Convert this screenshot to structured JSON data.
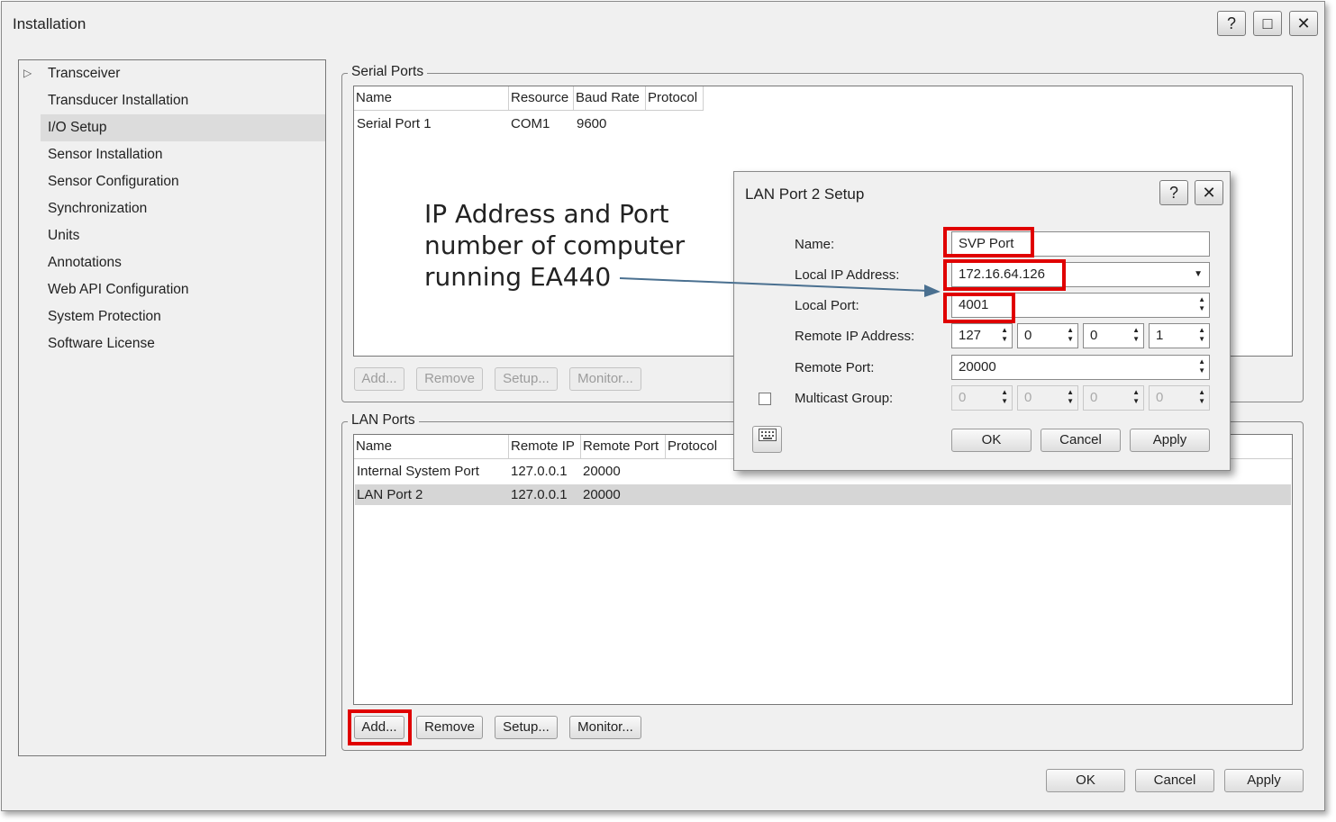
{
  "window": {
    "title": "Installation",
    "help": "?",
    "maximize": "□",
    "close": "✕"
  },
  "sidebar": {
    "items": [
      {
        "label": "Transceiver"
      },
      {
        "label": "Transducer Installation"
      },
      {
        "label": "I/O Setup"
      },
      {
        "label": "Sensor Installation"
      },
      {
        "label": "Sensor Configuration"
      },
      {
        "label": "Synchronization"
      },
      {
        "label": "Units"
      },
      {
        "label": "Annotations"
      },
      {
        "label": "Web API Configuration"
      },
      {
        "label": "System Protection"
      },
      {
        "label": "Software License"
      }
    ],
    "selected": "I/O Setup"
  },
  "serial_ports": {
    "title": "Serial Ports",
    "columns": [
      "Name",
      "Resource",
      "Baud Rate",
      "Protocol"
    ],
    "rows": [
      [
        "Serial Port 1",
        "COM1",
        "9600",
        ""
      ]
    ],
    "buttons": {
      "add": "Add...",
      "remove": "Remove",
      "setup": "Setup...",
      "monitor": "Monitor..."
    }
  },
  "lan_ports": {
    "title": "LAN Ports",
    "columns": [
      "Name",
      "Remote IP",
      "Remote Port",
      "Protocol"
    ],
    "rows": [
      [
        "Internal System Port",
        "127.0.0.1",
        "20000",
        ""
      ],
      [
        "LAN Port 2",
        "127.0.0.1",
        "20000",
        ""
      ]
    ],
    "buttons": {
      "add": "Add...",
      "remove": "Remove",
      "setup": "Setup...",
      "monitor": "Monitor..."
    }
  },
  "footer": {
    "ok": "OK",
    "cancel": "Cancel",
    "apply": "Apply"
  },
  "dialog": {
    "title": "LAN Port 2 Setup",
    "help": "?",
    "close": "✕",
    "name_label": "Name:",
    "name_value": "SVP Port",
    "local_ip_label": "Local IP Address:",
    "local_ip_value": "172.16.64.126",
    "local_port_label": "Local Port:",
    "local_port_value": "4001",
    "remote_ip_label": "Remote IP Address:",
    "remote_ip": [
      "127",
      "0",
      "0",
      "1"
    ],
    "remote_port_label": "Remote Port:",
    "remote_port_value": "20000",
    "multicast_label": "Multicast Group:",
    "multicast": [
      "0",
      "0",
      "0",
      "0"
    ],
    "ok": "OK",
    "cancel": "Cancel",
    "apply": "Apply"
  },
  "annotation": {
    "lines": [
      "IP Address and Port",
      "number of computer",
      "running EA440"
    ],
    "color": "#e00000",
    "arrow_color": "#4a7090"
  }
}
